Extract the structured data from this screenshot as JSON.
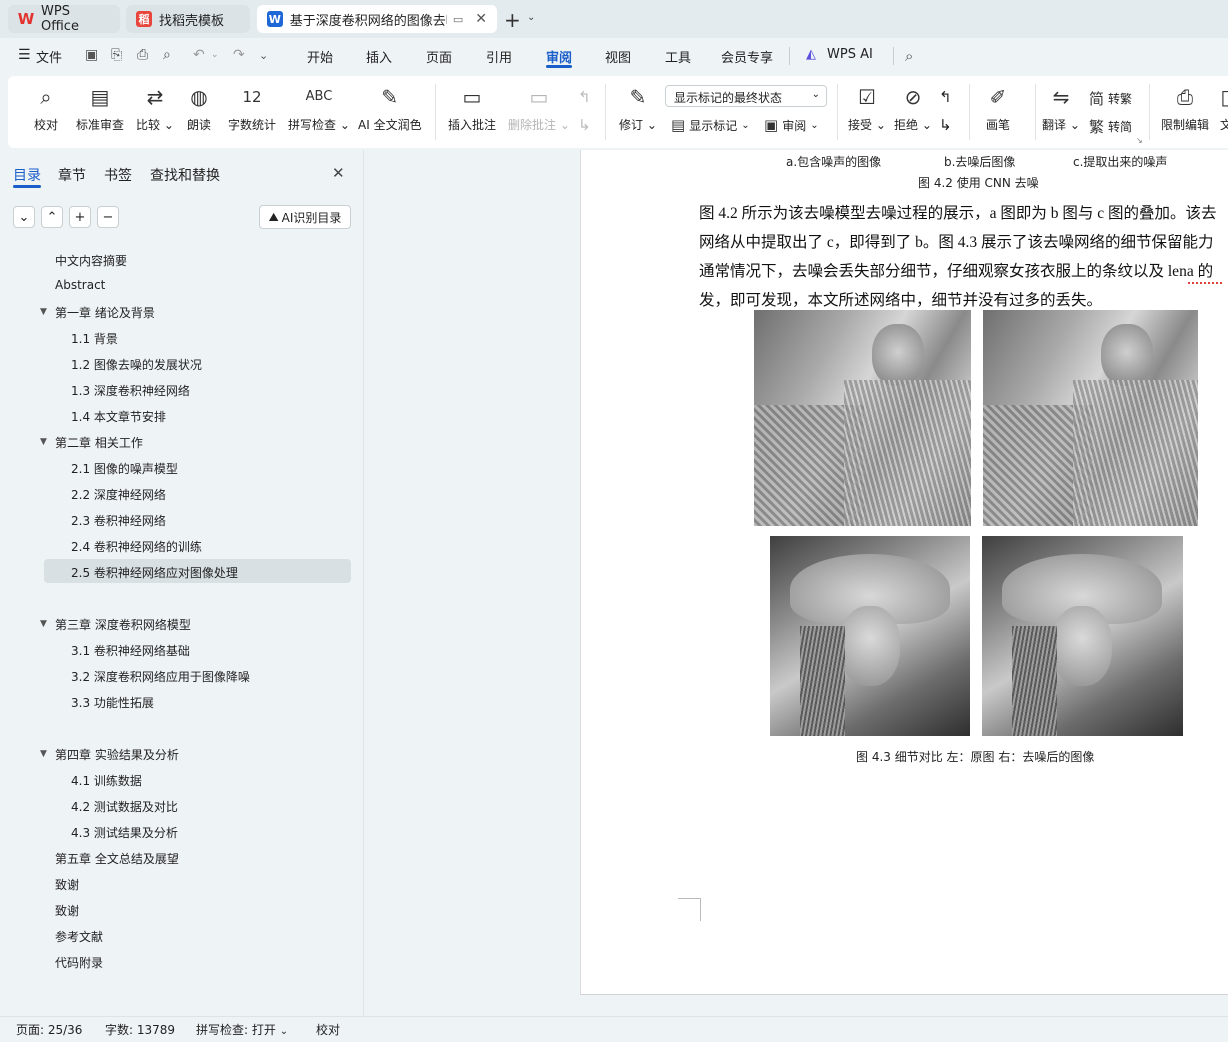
{
  "tabs": {
    "wps": "WPS Office",
    "template": "找稻壳模板",
    "doc": "基于深度卷积网络的图像去噪"
  },
  "menu": {
    "file": "文件",
    "items": [
      "开始",
      "插入",
      "页面",
      "引用",
      "审阅",
      "视图",
      "工具",
      "会员专享"
    ],
    "wps_ai": "WPS AI"
  },
  "ribbon": {
    "proofread": "校对",
    "std_review": "标准审查",
    "compare": "比较",
    "read_aloud": "朗读",
    "word_count": "字数统计",
    "spell_check": "拼写检查",
    "ai_polish": "AI 全文润色",
    "insert_comment": "插入批注",
    "delete_comment": "删除批注",
    "revise": "修订",
    "markup_mode": "显示标记的最终状态",
    "show_markup": "显示标记",
    "review": "审阅",
    "accept": "接受",
    "reject": "拒绝",
    "pen": "画笔",
    "translate": "翻译",
    "to_trad": "转繁",
    "to_simp": "转简",
    "restrict": "限制编辑",
    "doc_more": "文"
  },
  "sidebar": {
    "tabs": [
      "目录",
      "章节",
      "书签",
      "查找和替换"
    ],
    "ai_toc": "AI识别目录",
    "toc": [
      {
        "label": "中文内容摘要"
      },
      {
        "label": "Abstract"
      },
      {
        "label": "第一章  绪论及背景"
      },
      {
        "label": "1.1 背景"
      },
      {
        "label": "1.2  图像去噪的发展状况"
      },
      {
        "label": "1.3  深度卷积神经网络"
      },
      {
        "label": "1.4  本文章节安排"
      },
      {
        "label": "第二章  相关工作"
      },
      {
        "label": "2.1 图像的噪声模型"
      },
      {
        "label": "2.2 深度神经网络"
      },
      {
        "label": "2.3 卷积神经网络"
      },
      {
        "label": "2.4  卷积神经网络的训练"
      },
      {
        "label": "2.5  卷积神经网络应对图像处理"
      },
      {
        "label": "第三章  深度卷积网络模型"
      },
      {
        "label": "3.1  卷积神经网络基础"
      },
      {
        "label": "3.2  深度卷积网络应用于图像降噪"
      },
      {
        "label": "3.3  功能性拓展"
      },
      {
        "label": "第四章  实验结果及分析"
      },
      {
        "label": "4.1  训练数据"
      },
      {
        "label": "4.2  测试数据及对比"
      },
      {
        "label": "4.3  测试结果及分析"
      },
      {
        "label": "第五章  全文总结及展望"
      },
      {
        "label": "致谢"
      },
      {
        "label": "致谢"
      },
      {
        "label": "参考文献"
      },
      {
        "label": "代码附录"
      }
    ]
  },
  "document": {
    "sub_a": "a.包含噪声的图像",
    "sub_b": "b.去噪后图像",
    "sub_c": "c.提取出来的噪声",
    "fig42_caption": "图 4.2  使用 CNN 去噪",
    "para_lines": [
      "图 4.2 所示为该去噪模型去噪过程的展示，a 图即为 b 图与 c 图的叠加。该去",
      "网络从中提取出了 c，即得到了 b。图 4.3 展示了该去噪网络的细节保留能力",
      "通常情况下，去噪会丢失部分细节，仔细观察女孩衣服上的条纹以及 lena 的",
      "发，即可发现，本文所述网络中，细节并没有过多的丢失。"
    ],
    "fig43_caption": "图 4.3  细节对比  左：原图  右：去噪后的图像"
  },
  "status": {
    "page": "页面: 25/36",
    "words": "字数: 13789",
    "spell": "拼写检查: 打开",
    "proof": "校对"
  },
  "colors": {
    "accent": "#1a5ec9",
    "wps_red": "#e2332f",
    "template_red": "#e8453c",
    "doc_blue": "#1f67d6"
  }
}
